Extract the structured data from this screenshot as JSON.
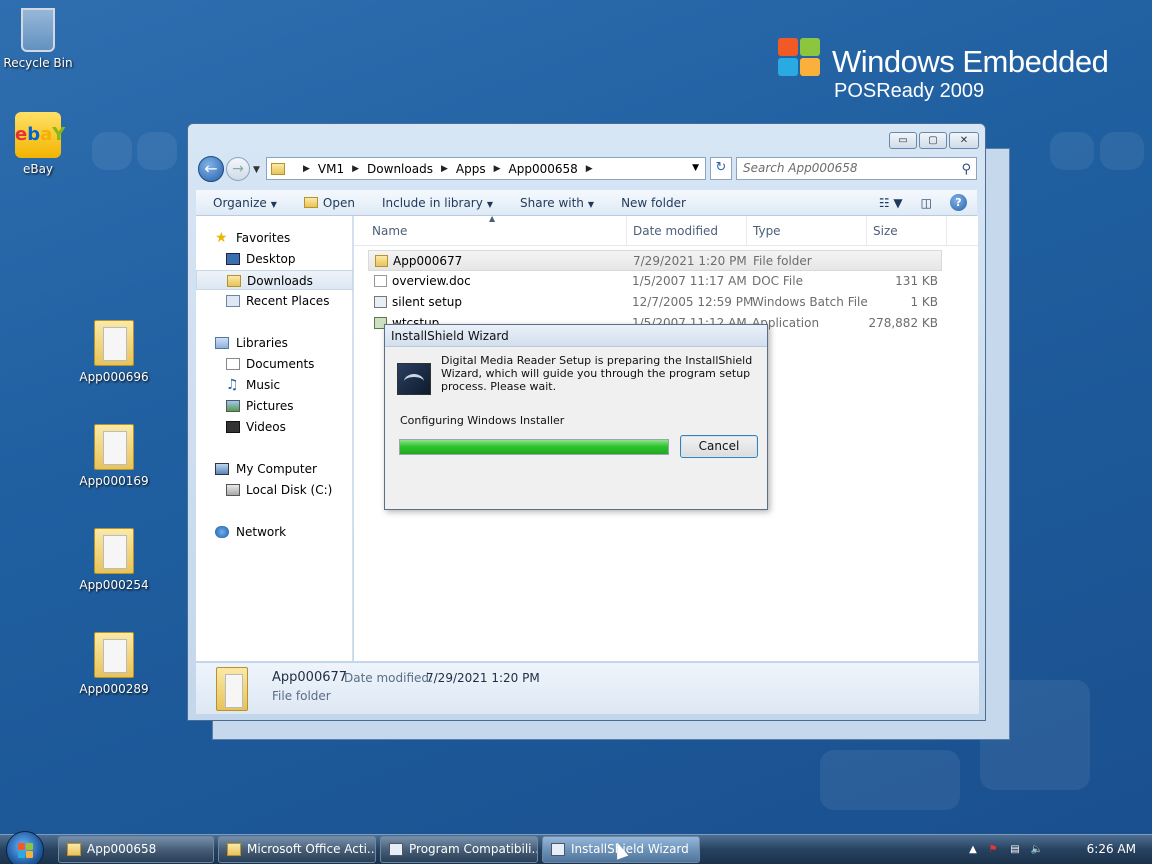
{
  "desktop": {
    "icons": [
      {
        "label": "Recycle Bin"
      },
      {
        "label": "eBay"
      },
      {
        "label": "App000696"
      },
      {
        "label": "App000169"
      },
      {
        "label": "App000254"
      },
      {
        "label": "App000289"
      }
    ],
    "ebay_logo": {
      "e": "e",
      "b": "b",
      "a": "a",
      "y": "Y"
    },
    "brand": {
      "line1": "Windows Embedded",
      "line2": "POSReady 2009"
    }
  },
  "explorer": {
    "caption_buttons": {
      "minimize": "▭",
      "maximize": "▢",
      "close": "✕"
    },
    "breadcrumb": [
      "VM1",
      "Downloads",
      "Apps",
      "App000658"
    ],
    "search_placeholder": "Search App000658",
    "toolbar": {
      "organize": "Organize",
      "open": "Open",
      "include": "Include in library",
      "share": "Share with",
      "new_folder": "New folder"
    },
    "nav": {
      "favorites": "Favorites",
      "desktop": "Desktop",
      "downloads": "Downloads",
      "recent": "Recent Places",
      "libraries": "Libraries",
      "documents": "Documents",
      "music": "Music",
      "pictures": "Pictures",
      "videos": "Videos",
      "computer": "My Computer",
      "local_disk": "Local Disk (C:)",
      "network": "Network"
    },
    "columns": {
      "name": "Name",
      "date": "Date modified",
      "type": "Type",
      "size": "Size"
    },
    "files": [
      {
        "name": "App000677",
        "date": "7/29/2021 1:20 PM",
        "type": "File folder",
        "size": ""
      },
      {
        "name": "overview.doc",
        "date": "1/5/2007 11:17 AM",
        "type": "DOC File",
        "size": "131 KB"
      },
      {
        "name": "silent setup",
        "date": "12/7/2005 12:59 PM",
        "type": "Windows Batch File",
        "size": "1 KB"
      },
      {
        "name": "wtcstup",
        "date": "1/5/2007 11:12 AM",
        "type": "Application",
        "size": "278,882 KB"
      }
    ],
    "details": {
      "name": "App000677",
      "date_label": "Date modified:",
      "date_value": "7/29/2021 1:20 PM",
      "kind": "File folder"
    }
  },
  "dialog": {
    "title": "InstallShield Wizard",
    "message": "Digital Media Reader Setup is preparing the InstallShield Wizard, which will guide you through the program setup process.  Please wait.",
    "status": "Configuring Windows Installer",
    "progress": 1.0,
    "cancel": "Cancel"
  },
  "taskbar": {
    "buttons": [
      {
        "label": "App000658"
      },
      {
        "label": "Microsoft Office Acti..."
      },
      {
        "label": "Program Compatibili..."
      },
      {
        "label": "InstallShield Wizard"
      }
    ],
    "clock": "6:26 AM"
  },
  "colors": {
    "accent": "#2961a8",
    "progress": "#2fc42f",
    "desktop": "#1f5fa0"
  }
}
